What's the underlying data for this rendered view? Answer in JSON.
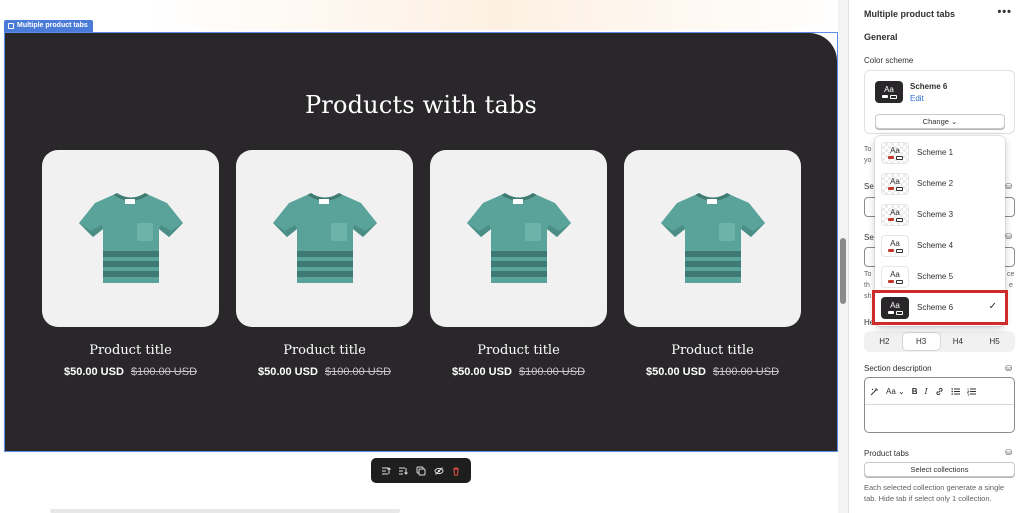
{
  "section_tag": {
    "label": "Multiple product tabs"
  },
  "preview": {
    "section_title": "Products with tabs",
    "products": [
      {
        "title": "Product title",
        "price": "$50.00 USD",
        "compare_price": "$100.00 USD"
      },
      {
        "title": "Product title",
        "price": "$50.00 USD",
        "compare_price": "$100.00 USD"
      },
      {
        "title": "Product title",
        "price": "$50.00 USD",
        "compare_price": "$100.00 USD"
      },
      {
        "title": "Product title",
        "price": "$50.00 USD",
        "compare_price": "$100.00 USD"
      }
    ],
    "toolbar_icons": [
      "move-up-icon",
      "move-down-icon",
      "duplicate-icon",
      "hide-icon",
      "delete-icon"
    ]
  },
  "panel": {
    "title": "Multiple product tabs",
    "more_icon": "more-horizontal-icon",
    "general_label": "General",
    "color_scheme_label": "Color scheme",
    "current_scheme": {
      "name": "Scheme 6",
      "edit_label": "Edit",
      "preview_text": "Aa"
    },
    "change_label": "Change",
    "partial_text": {
      "to": "To",
      "yo": "yo",
      "se1": "Se",
      "se2": "Se",
      "to2": "To",
      "th": "th",
      "sh": "sh",
      "he": "He",
      "ce": "ce",
      "e": "e"
    },
    "heading_options": [
      "H2",
      "H3",
      "H4",
      "H5"
    ],
    "heading_selected": "H3",
    "section_description_label": "Section description",
    "rte": {
      "font_label": "Aa",
      "bold": "B",
      "italic": "I"
    },
    "product_tabs_label": "Product tabs",
    "select_collections_label": "Select collections",
    "help_text": "Each selected collection generate a single tab. Hide tab if select only 1 collection."
  },
  "dropdown": {
    "options": [
      {
        "name": "Scheme 1",
        "preview_text": "Aa",
        "style": "light"
      },
      {
        "name": "Scheme 2",
        "preview_text": "Aa",
        "style": "light"
      },
      {
        "name": "Scheme 3",
        "preview_text": "Aa",
        "style": "light"
      },
      {
        "name": "Scheme 4",
        "preview_text": "Aa",
        "style": "white"
      },
      {
        "name": "Scheme 5",
        "preview_text": "Aa",
        "style": "white"
      },
      {
        "name": "Scheme 6",
        "preview_text": "Aa",
        "style": "dark"
      }
    ],
    "selected": "Scheme 6",
    "check_glyph": "✓"
  },
  "colors": {
    "section_bg": "#2a272b",
    "accent_blue": "#4a7bd6",
    "link_blue": "#2c6ecb",
    "highlight_red": "#d12a2a",
    "shirt_teal": "#5aa39a"
  }
}
